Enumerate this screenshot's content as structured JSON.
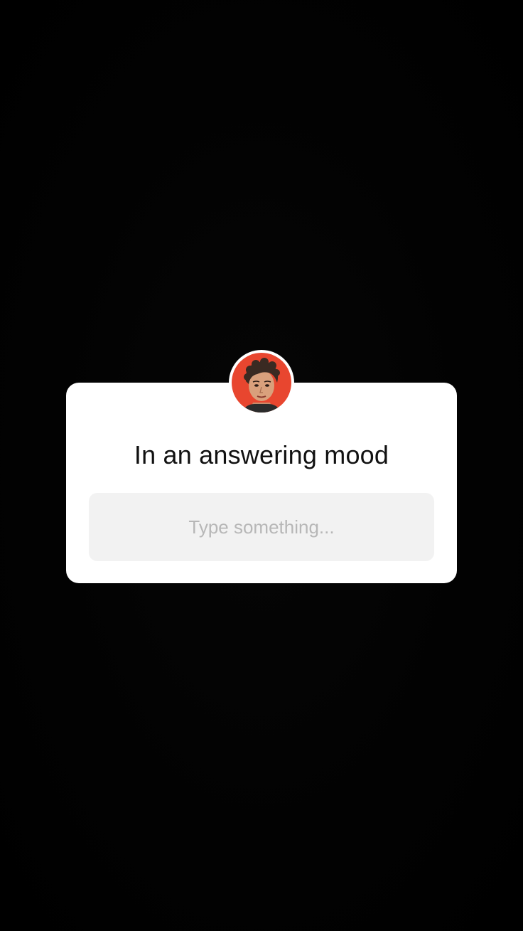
{
  "story": {
    "background_color": "#000000"
  },
  "question_sticker": {
    "avatar_icon": "profile-avatar-icon",
    "avatar_bg_color": "#e8462f",
    "prompt": "In an answering mood",
    "answer_placeholder": "Type something..."
  }
}
